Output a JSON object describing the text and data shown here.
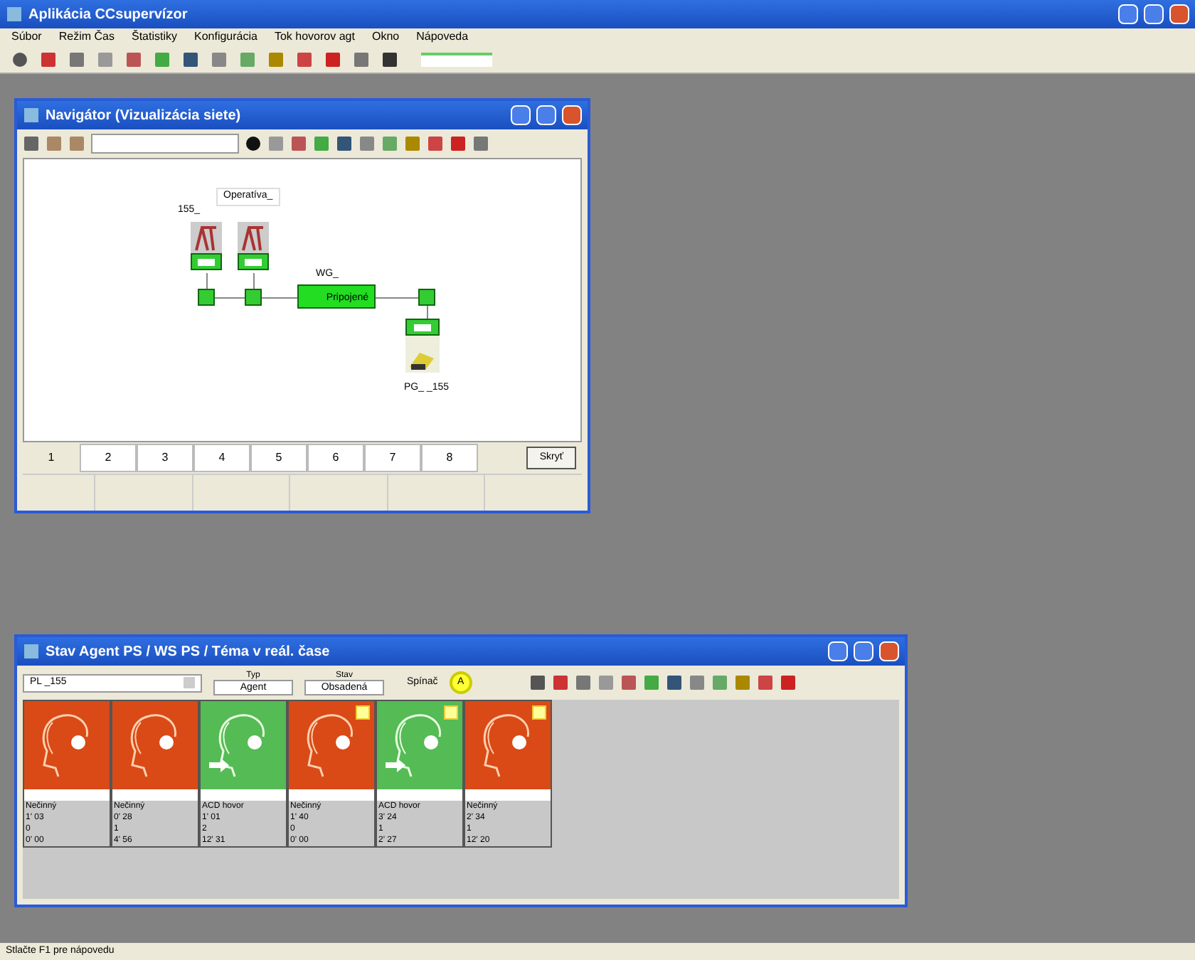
{
  "window": {
    "title": "Aplikácia CCsupervízor"
  },
  "menu": [
    "Súbor",
    "Režim Čas",
    "Štatistiky",
    "Konfigurácia",
    "Tok hovorov agt",
    "Okno",
    "Nápoveda"
  ],
  "navigator": {
    "title": "Navigátor (Vizualizácia siete)",
    "labels": {
      "operator": "Operatíva_",
      "group": "155_",
      "workgroup": "WG_",
      "workgroup_state": "Pripojené",
      "pg": "PG_ _155"
    },
    "tabs": [
      {
        "label": "1",
        "selected": true
      },
      {
        "label": "2",
        "selected": false
      },
      {
        "label": "3",
        "selected": false
      },
      {
        "label": "4",
        "selected": false
      },
      {
        "label": "5",
        "selected": false
      },
      {
        "label": "6",
        "selected": false
      },
      {
        "label": "7",
        "selected": false
      },
      {
        "label": "8",
        "selected": false
      }
    ],
    "button": "Skryť"
  },
  "agents_window": {
    "title": "Stav Agent PS / WS PS / Téma v reál. čase",
    "selector": "PL _155",
    "type_label": "Typ",
    "type_value": "Agent",
    "state_label": "Stav",
    "state_value": "Obsadená",
    "switch_label": "Spínač",
    "switch_value": "A",
    "agents": [
      {
        "kind": "idle",
        "flagged": false,
        "lines": [
          "Nečinný",
          "1' 03",
          "0",
          "0' 00"
        ]
      },
      {
        "kind": "idle",
        "flagged": false,
        "lines": [
          "Nečinný",
          "0' 28",
          "1",
          "4' 56"
        ]
      },
      {
        "kind": "call",
        "flagged": false,
        "lines": [
          "ACD hovor",
          "1' 01",
          "2",
          "12' 31"
        ]
      },
      {
        "kind": "idle",
        "flagged": true,
        "lines": [
          "Nečinný",
          "1' 40",
          "0",
          "0' 00"
        ]
      },
      {
        "kind": "call",
        "flagged": true,
        "lines": [
          "ACD hovor",
          "3' 24",
          "1",
          "2' 27"
        ]
      },
      {
        "kind": "idle",
        "flagged": true,
        "lines": [
          "Nečinný",
          "2' 34",
          "1",
          "12' 20"
        ]
      }
    ]
  },
  "status_bar": "Stlačte F1 pre nápovedu"
}
